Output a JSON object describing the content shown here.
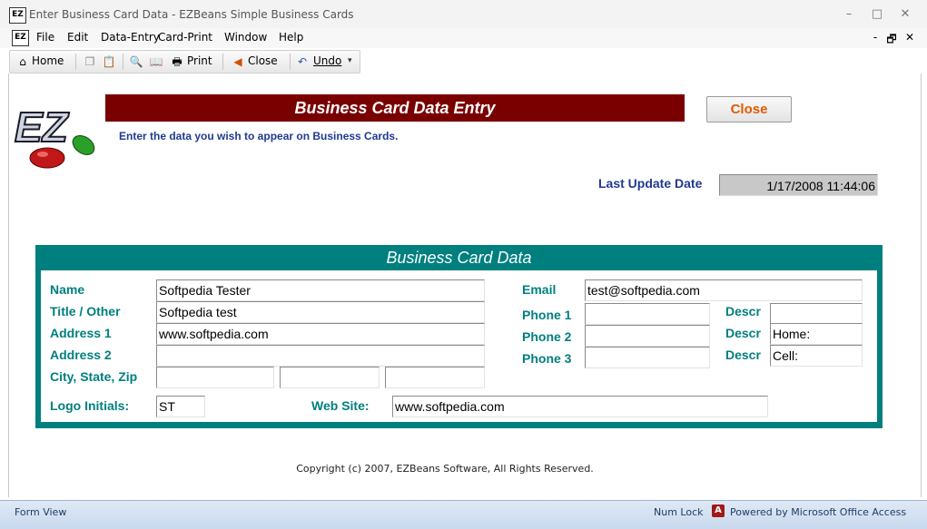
{
  "window": {
    "title": "Enter Business Card Data - EZBeans Simple Business Cards",
    "app_icon_text": "EZ",
    "controls": {
      "minimize": "–",
      "maximize": "□",
      "close": "✕"
    }
  },
  "menubar": {
    "items": [
      "File",
      "Edit",
      "Data-Entry",
      "Card-Print",
      "Window",
      "Help"
    ],
    "doc_controls": {
      "minimize": "-",
      "restore": "🗗",
      "close": "✕"
    }
  },
  "toolbar": {
    "home_label": "Home",
    "print_label": "Print",
    "close_label": "Close",
    "undo_label": "Undo"
  },
  "form": {
    "logo_text": "EZ",
    "header_title": "Business Card Data Entry",
    "subtitle": "Enter the data you wish to appear on Business Cards.",
    "close_button": "Close",
    "last_update_label": "Last Update Date",
    "last_update_value": "1/17/2008 11:44:06",
    "panel_title": "Business Card Data",
    "labels": {
      "name": "Name",
      "title": "Title / Other",
      "address1": "Address 1",
      "address2": "Address 2",
      "city_state_zip": "City, State, Zip",
      "logo_initials": "Logo Initials:",
      "web_site": "Web Site:",
      "email": "Email",
      "phone1": "Phone 1",
      "phone2": "Phone 2",
      "phone3": "Phone 3",
      "descr": "Descr"
    },
    "values": {
      "name": "Softpedia Tester",
      "title": "Softpedia test",
      "address1": "www.softpedia.com",
      "address2": "",
      "city": "",
      "state": "",
      "zip": "",
      "logo_initials": "ST",
      "web_site": "www.softpedia.com",
      "email": "test@softpedia.com",
      "phone1": "",
      "phone2": "",
      "phone3": "",
      "descr1": "",
      "descr2": "Home:",
      "descr3": "Cell:"
    },
    "copyright": "Copyright (c) 2007, EZBeans Software, All Rights Reserved."
  },
  "statusbar": {
    "view": "Form View",
    "numlock": "Num Lock",
    "powered_by": "Powered by Microsoft Office Access"
  },
  "colors": {
    "header_bar": "#7a0000",
    "panel_teal": "#007f7f",
    "label_blue": "#1f3a93",
    "close_orange": "#e35a00"
  }
}
